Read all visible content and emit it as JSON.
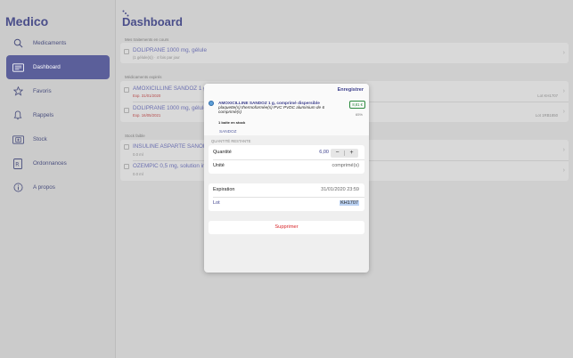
{
  "app": {
    "title": "Medico"
  },
  "sidebar": {
    "items": [
      {
        "label": "Medicaments",
        "icon": "search-icon"
      },
      {
        "label": "Dashboard",
        "icon": "dashboard-icon",
        "active": true
      },
      {
        "label": "Favoris",
        "icon": "star-icon"
      },
      {
        "label": "Rappels",
        "icon": "bell-icon"
      },
      {
        "label": "Stock",
        "icon": "stock-icon"
      },
      {
        "label": "Ordonnances",
        "icon": "prescription-icon"
      },
      {
        "label": "A propos",
        "icon": "info-icon"
      }
    ]
  },
  "main": {
    "title": "Dashboard",
    "sections": {
      "current": {
        "label": "Mes traitements en cours",
        "rows": [
          {
            "name": "DOLIPRANE 1000 mg, gélule",
            "sub": "(1 gélule(s)) · 4 fois par jour"
          }
        ]
      },
      "expired": {
        "label": "Médicaments expirés",
        "rows": [
          {
            "name": "AMOXICILLINE SANDOZ 1 g, c",
            "sub": "Exp. 31/01/2020",
            "right": "Lot KH1707"
          },
          {
            "name": "DOLIPRANE 1000 mg, gélule",
            "sub": "Exp. 16/05/2021",
            "right": "Lot 1RB1850"
          }
        ]
      },
      "low_stock": {
        "label": "Stock faible",
        "rows": [
          {
            "name": "INSULINE ASPARTE SANOFI 10",
            "sub": "0.0 ml"
          },
          {
            "name": "OZEMPIC 0,5 mg, solution inje",
            "sub": "0.0 ml"
          }
        ]
      }
    }
  },
  "modal": {
    "save_label": "Enregistrer",
    "drug_title": "AMOXICILLINE SANDOZ 1 g, comprimé dispersible",
    "drug_detail": "plaquette(s) thermoformée(s) PVC PVDC aluminium de 6 comprimé(s)",
    "price": "8,81 €",
    "reimbursement": "65%",
    "box_stock": "1 boite en stock",
    "lab": "SANDOZ",
    "quantity_section": "QUANTITÉ RESTANTE",
    "quantity_label": "Quantité",
    "quantity_value": "6,00",
    "stepper_minus": "−",
    "stepper_plus": "+",
    "unit_label": "Unité",
    "unit_value": "comprimé(s)",
    "expiration_label": "Expiration",
    "expiration_value": "31/01/2020 23:59",
    "lot_label": "Lot",
    "lot_value": "KH1707",
    "delete_label": "Supprimer"
  },
  "colors": {
    "accent": "#4a4e8a",
    "active_nav": "#5b5f9a",
    "danger": "#d8262a",
    "price_green": "#2b8a3e"
  }
}
